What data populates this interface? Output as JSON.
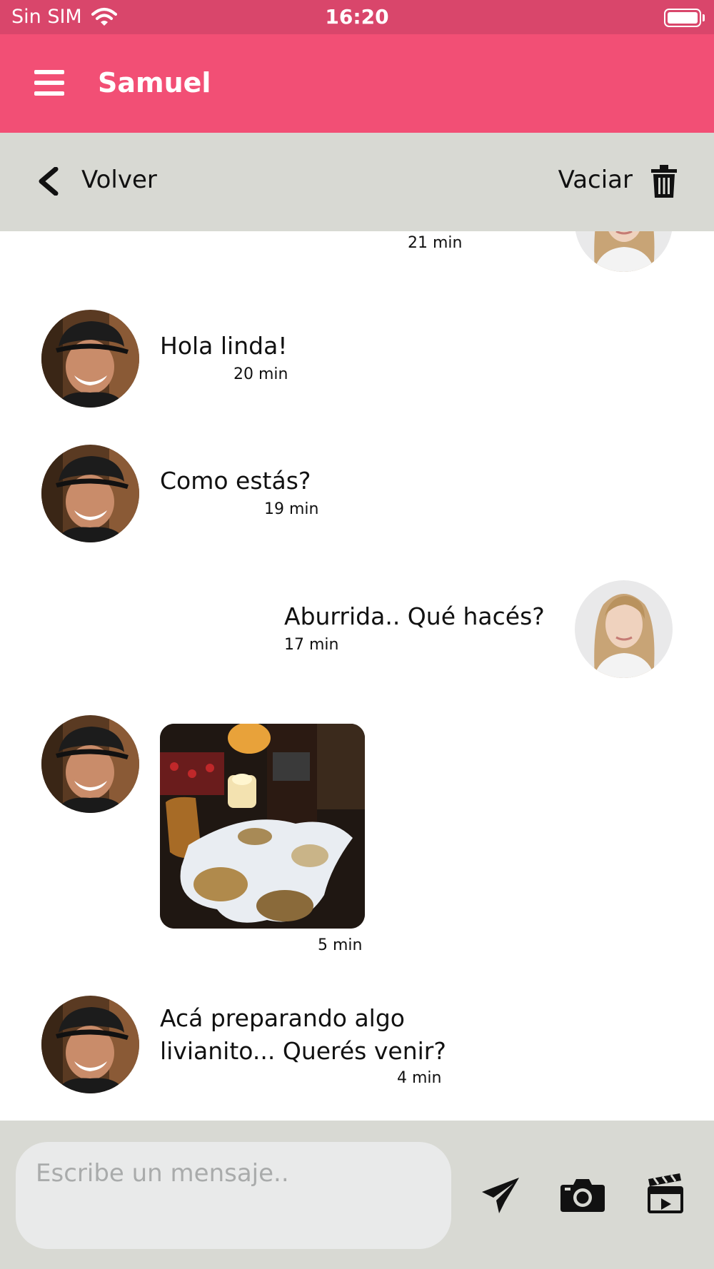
{
  "status_bar": {
    "carrier": "Sin SIM",
    "time": "16:20"
  },
  "header": {
    "title": "Samuel"
  },
  "toolbar": {
    "back_label": "Volver",
    "clear_label": "Vaciar"
  },
  "messages": [
    {
      "sender": "self",
      "time": "21 min"
    },
    {
      "sender": "other",
      "text": "Hola linda!",
      "time": "20 min"
    },
    {
      "sender": "other",
      "text": "Como estás?",
      "time": "19 min"
    },
    {
      "sender": "self",
      "text": "Aburrida.. Qué hacés?",
      "time": "17 min"
    },
    {
      "sender": "other",
      "type": "image",
      "time": "5 min"
    },
    {
      "sender": "other",
      "text_lines": [
        "Acá preparando algo",
        "livianito... Querés venir?"
      ],
      "time": "4 min"
    }
  ],
  "composer": {
    "placeholder": "Escribe un mensaje.."
  },
  "icons": {
    "menu": "hamburger-menu-icon",
    "back": "chevron-left-icon",
    "clear": "trash-icon",
    "send": "paper-plane-icon",
    "camera": "camera-icon",
    "video": "clapperboard-icon",
    "wifi": "wifi-icon",
    "battery": "battery-icon"
  },
  "colors": {
    "status_bar": "#d9466b",
    "header": "#f24f75",
    "toolbar": "#d8d9d3",
    "input": "#e9eaea",
    "placeholder": "#a9abab"
  }
}
